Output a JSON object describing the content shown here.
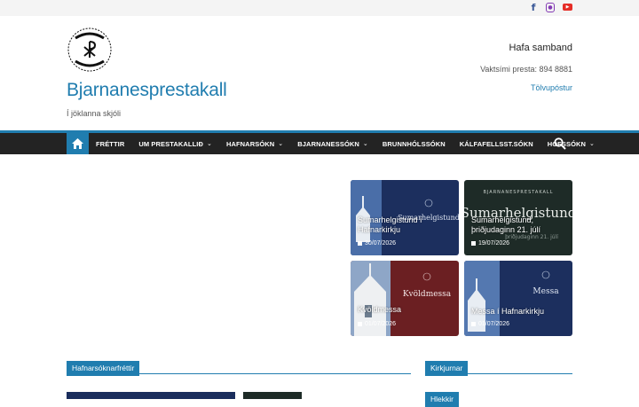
{
  "social": {
    "facebook_icon": "facebook-icon",
    "instagram_icon": "instagram-icon",
    "youtube_icon": "youtube-icon"
  },
  "brand": {
    "logo_text_top": "BJARNANES",
    "logo_text_bottom": "PRESTAKALL",
    "title": "Bjarnanesprestakall",
    "tagline": "Í jöklanna skjóli"
  },
  "contact": {
    "title": "Hafa samband",
    "phone": "Vaktsími presta: 894 8881",
    "email": "Tölvupóstur"
  },
  "nav": {
    "items": [
      {
        "label": "FRÉTTIR",
        "dropdown": false
      },
      {
        "label": "UM PRESTAKALLIÐ",
        "dropdown": true
      },
      {
        "label": "HAFNARSÓKN",
        "dropdown": true
      },
      {
        "label": "BJARNANESSÓKN",
        "dropdown": true
      },
      {
        "label": "BRUNNHÓLSSÓKN",
        "dropdown": false
      },
      {
        "label": "KÁLFAFELLSST.SÓKN",
        "dropdown": false
      },
      {
        "label": "HOFSSÓKN",
        "dropdown": true
      }
    ],
    "colors": {
      "bar": "#232323",
      "accent": "#207daf"
    }
  },
  "cards": [
    {
      "title_l1": "Sumarhelgistund í",
      "title_l2": "Hafnarkirkju",
      "date": "30/07/2026",
      "bg_text": "Sumarhelgistund"
    },
    {
      "title_l1": "Sumarhelgistund,",
      "title_l2": "þriðjudaginn 21. júlí",
      "date": "19/07/2026",
      "bg_text": "Sumarhelgistund",
      "bg_header": "BJARNANESPRESTAKALL",
      "bg_sub": "þriðjudaginn 21. júlí"
    },
    {
      "title_l1": "Kvöldmessa",
      "title_l2": "",
      "date": "01/07/2026",
      "bg_text": "Kvöldmessa"
    },
    {
      "title_l1": "Messa í Hafnarkirkju",
      "title_l2": "",
      "date": "01/07/2026",
      "bg_text": "Messa"
    }
  ],
  "sections": {
    "left": "Hafnarsóknarfréttir",
    "right": "Kirkjurnar",
    "links": "Hlekkir"
  }
}
